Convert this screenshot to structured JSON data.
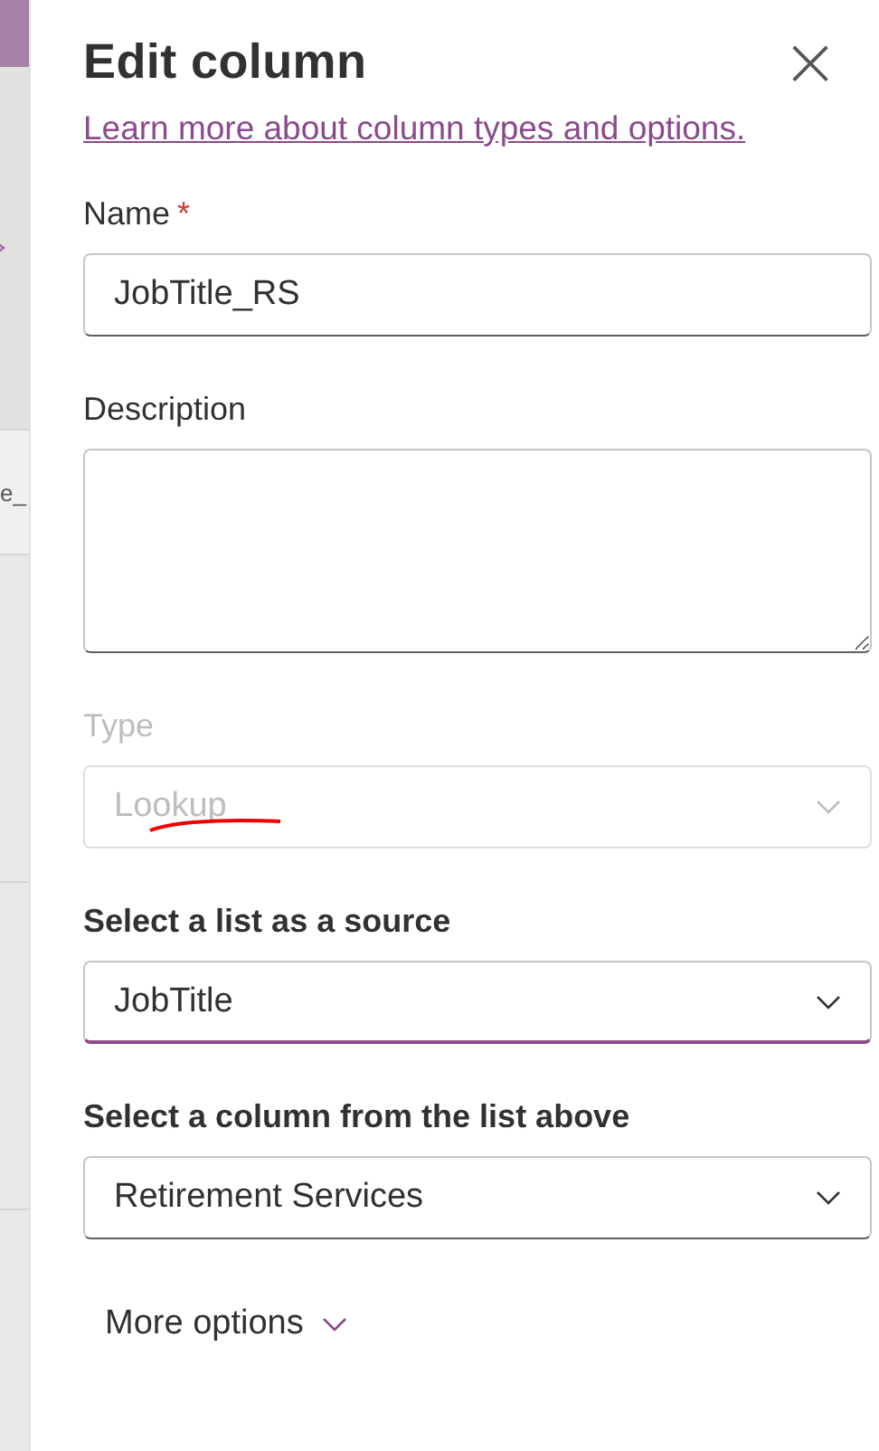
{
  "background": {
    "text_fragment": "e_"
  },
  "panel": {
    "title": "Edit column",
    "close_icon": "×",
    "help_link": "Learn more about column types and options.",
    "fields": [
      {
        "kind": "text",
        "label": "Name",
        "required_mark": "*",
        "value": "JobTitle_RS",
        "disabled": false,
        "focused": false,
        "bold_label": false
      },
      {
        "kind": "textarea",
        "label": "Description",
        "disabled": false,
        "focused": false,
        "bold_label": false
      },
      {
        "kind": "dropdown",
        "label": "Type",
        "placeholder": "Lookup",
        "disabled": true,
        "focused": false,
        "bold_label": false,
        "annotated": true
      },
      {
        "kind": "dropdown",
        "label": "Select a list as a source",
        "value": "JobTitle",
        "disabled": false,
        "focused": true,
        "bold_label": true
      },
      {
        "kind": "dropdown",
        "label": "Select a column from the list above",
        "value": "Retirement Services",
        "disabled": false,
        "focused": false,
        "bold_label": true
      }
    ],
    "more_options": "More options"
  }
}
